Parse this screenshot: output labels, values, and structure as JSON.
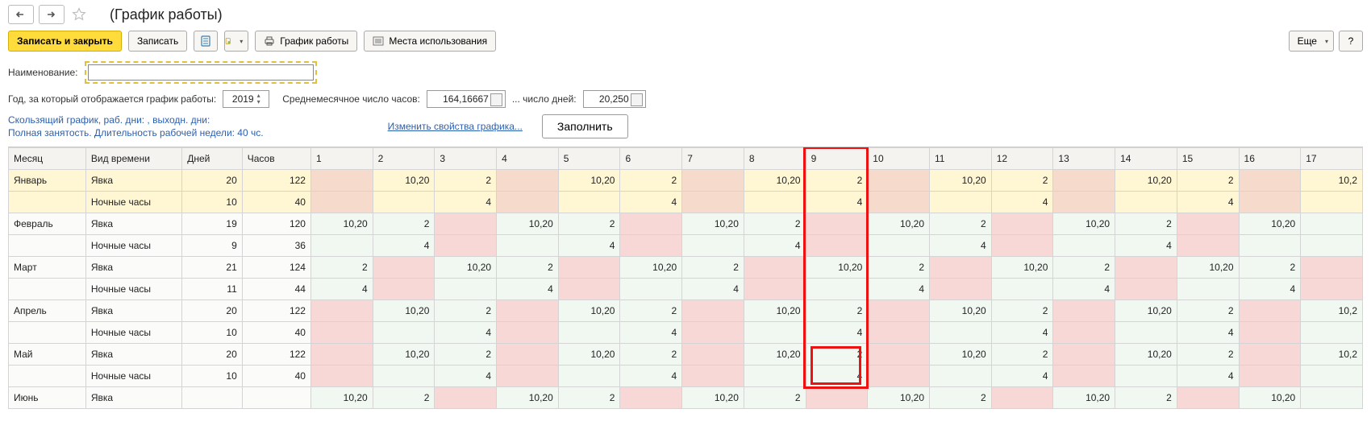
{
  "title": "(График работы)",
  "toolbar": {
    "write_close": "Записать и закрыть",
    "write": "Записать",
    "print_schedule": "График работы",
    "usage_places": "Места использования",
    "more": "Еще",
    "help": "?"
  },
  "form": {
    "name_label": "Наименование:",
    "name_value": "",
    "year_label": "Год, за который отображается график работы:",
    "year_value": "2019",
    "avg_hours_label": "Среднемесячное число часов:",
    "avg_hours_value": "164,16667",
    "days_label": "... число дней:",
    "days_value": "20,250"
  },
  "info": {
    "line1": "Скользящий график, раб. дни: , выходн. дни:",
    "line2": "Полная занятость. Длительность рабочей недели: 40 чс.",
    "change_props": "Изменить свойства графика...",
    "fill": "Заполнить"
  },
  "grid": {
    "headers": {
      "month": "Месяц",
      "type": "Вид времени",
      "days": "Дней",
      "hours": "Часов"
    },
    "day_cols": [
      1,
      2,
      3,
      4,
      5,
      6,
      7,
      8,
      9,
      10,
      11,
      12,
      13,
      14,
      15,
      16,
      17
    ],
    "months": [
      {
        "name": "Январь",
        "rows": [
          {
            "type": "Явка",
            "days": "20",
            "hours": "122",
            "cells": [
              "",
              "10,20",
              "2",
              "",
              "10,20",
              "2",
              "",
              "10,20",
              "2",
              "",
              "10,20",
              "2",
              "",
              "10,20",
              "2",
              "",
              "10,2"
            ],
            "pink": [
              1,
              4,
              7,
              10,
              13,
              16
            ]
          },
          {
            "type": "Ночные часы",
            "days": "10",
            "hours": "40",
            "cells": [
              "",
              "",
              "4",
              "",
              "",
              "4",
              "",
              "",
              "4",
              "",
              "",
              "4",
              "",
              "",
              "4",
              "",
              ""
            ],
            "pink": [
              1,
              4,
              7,
              10,
              13,
              16
            ]
          }
        ]
      },
      {
        "name": "Февраль",
        "rows": [
          {
            "type": "Явка",
            "days": "19",
            "hours": "120",
            "cells": [
              "10,20",
              "2",
              "",
              "10,20",
              "2",
              "",
              "10,20",
              "2",
              "",
              "10,20",
              "2",
              "",
              "10,20",
              "2",
              "",
              "10,20",
              ""
            ],
            "pink": [
              3,
              6,
              9,
              12,
              15
            ]
          },
          {
            "type": "Ночные часы",
            "days": "9",
            "hours": "36",
            "cells": [
              "",
              "4",
              "",
              "",
              "4",
              "",
              "",
              "4",
              "",
              "",
              "4",
              "",
              "",
              "4",
              "",
              "",
              ""
            ],
            "pink": [
              3,
              6,
              9,
              12,
              15
            ]
          }
        ]
      },
      {
        "name": "Март",
        "rows": [
          {
            "type": "Явка",
            "days": "21",
            "hours": "124",
            "cells": [
              "2",
              "",
              "10,20",
              "2",
              "",
              "10,20",
              "2",
              "",
              "10,20",
              "2",
              "",
              "10,20",
              "2",
              "",
              "10,20",
              "2",
              ""
            ],
            "pink": [
              2,
              5,
              8,
              11,
              14,
              17
            ]
          },
          {
            "type": "Ночные часы",
            "days": "11",
            "hours": "44",
            "cells": [
              "4",
              "",
              "",
              "4",
              "",
              "",
              "4",
              "",
              "",
              "4",
              "",
              "",
              "4",
              "",
              "",
              "4",
              ""
            ],
            "pink": [
              2,
              5,
              8,
              11,
              14,
              17
            ]
          }
        ]
      },
      {
        "name": "Апрель",
        "rows": [
          {
            "type": "Явка",
            "days": "20",
            "hours": "122",
            "cells": [
              "",
              "10,20",
              "2",
              "",
              "10,20",
              "2",
              "",
              "10,20",
              "2",
              "",
              "10,20",
              "2",
              "",
              "10,20",
              "2",
              "",
              "10,2"
            ],
            "pink": [
              1,
              4,
              7,
              10,
              13,
              16
            ]
          },
          {
            "type": "Ночные часы",
            "days": "10",
            "hours": "40",
            "cells": [
              "",
              "",
              "4",
              "",
              "",
              "4",
              "",
              "",
              "4",
              "",
              "",
              "4",
              "",
              "",
              "4",
              "",
              ""
            ],
            "pink": [
              1,
              4,
              7,
              10,
              13,
              16
            ]
          }
        ]
      },
      {
        "name": "Май",
        "rows": [
          {
            "type": "Явка",
            "days": "20",
            "hours": "122",
            "cells": [
              "",
              "10,20",
              "2",
              "",
              "10,20",
              "2",
              "",
              "10,20",
              "2",
              "",
              "10,20",
              "2",
              "",
              "10,20",
              "2",
              "",
              "10,2"
            ],
            "pink": [
              1,
              4,
              7,
              10,
              13,
              16
            ]
          },
          {
            "type": "Ночные часы",
            "days": "10",
            "hours": "40",
            "cells": [
              "",
              "",
              "4",
              "",
              "",
              "4",
              "",
              "",
              "4",
              "",
              "",
              "4",
              "",
              "",
              "4",
              "",
              ""
            ],
            "pink": [
              1,
              4,
              7,
              10,
              13,
              16
            ]
          }
        ]
      },
      {
        "name": "Июнь",
        "rows": [
          {
            "type": "Явка",
            "days": "",
            "hours": "",
            "cells": [
              "10,20",
              "2",
              "",
              "10,20",
              "2",
              "",
              "10,20",
              "2",
              "",
              "10,20",
              "2",
              "",
              "10,20",
              "2",
              "",
              "10,20",
              ""
            ],
            "pink": [
              3,
              6,
              9,
              12,
              15
            ]
          }
        ]
      }
    ]
  }
}
